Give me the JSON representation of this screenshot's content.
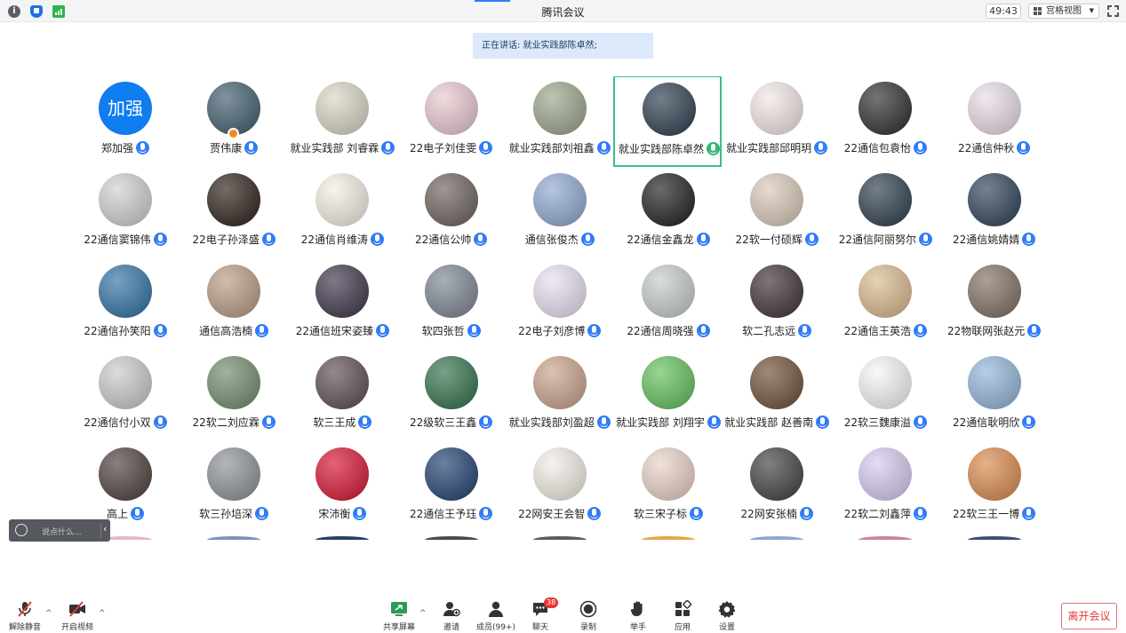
{
  "window": {
    "title": "腾讯会议",
    "timer": "49:43",
    "view_mode": "宫格视图"
  },
  "banner": {
    "speaking": "正在讲话: 就业实践部陈卓然;"
  },
  "participants": [
    {
      "name": "郑加强",
      "avatar_text": "加强",
      "avatar_color": "#0f7cf0"
    },
    {
      "name": "贾伟康",
      "avatar_color": "#3d5a6c",
      "host": true
    },
    {
      "name": "就业实践部 刘睿霖",
      "avatar_color": "#d9d4c3"
    },
    {
      "name": "22电子刘佳雯",
      "avatar_color": "#e8c8cf"
    },
    {
      "name": "就业实践部刘祖鑫",
      "avatar_color": "#9aa489"
    },
    {
      "name": "就业实践部陈卓然",
      "avatar_color": "#2b3a4d",
      "speaking": true
    },
    {
      "name": "就业实践部邱明玥",
      "avatar_color": "#f2e7e4"
    },
    {
      "name": "22通信包袁怡",
      "avatar_color": "#2a2a2a"
    },
    {
      "name": "22通信仲秋",
      "avatar_color": "#eadbe6"
    },
    {
      "name": "22通信窦锦伟",
      "avatar_color": "#cfcfcf"
    },
    {
      "name": "22电子孙泽盛",
      "avatar_color": "#2a1d16"
    },
    {
      "name": "22通信肖维涛",
      "avatar_color": "#f4efe3"
    },
    {
      "name": "22通信公帅",
      "avatar_color": "#6a5f5a"
    },
    {
      "name": "通信张俊杰",
      "avatar_color": "#8ea7cf"
    },
    {
      "name": "22通信金鑫龙",
      "avatar_color": "#1b1b1b"
    },
    {
      "name": "22软一付硕辉",
      "avatar_color": "#d8c8b8"
    },
    {
      "name": "22通信阿丽努尔",
      "avatar_color": "#2a3a4c"
    },
    {
      "name": "22通信姚婧婧",
      "avatar_color": "#2a3e55"
    },
    {
      "name": "22通信孙笑阳",
      "avatar_color": "#2d6fa3"
    },
    {
      "name": "通信高浩楠",
      "avatar_color": "#b79a82"
    },
    {
      "name": "22通信班宋姿臻",
      "avatar_color": "#3a3246"
    },
    {
      "name": "软四张哲",
      "avatar_color": "#7b8490"
    },
    {
      "name": "22电子刘彦博",
      "avatar_color": "#e9dff1"
    },
    {
      "name": "22通信周晓强",
      "avatar_color": "#c4ccc9"
    },
    {
      "name": "软二孔志远",
      "avatar_color": "#3c2d32"
    },
    {
      "name": "22通信王英浩",
      "avatar_color": "#d9b98d"
    },
    {
      "name": "22物联网张赵元",
      "avatar_color": "#7d6e5f"
    },
    {
      "name": "22通信付小双",
      "avatar_color": "#c9c9c9"
    },
    {
      "name": "22软二刘应霖",
      "avatar_color": "#6f8a6a"
    },
    {
      "name": "软三王成",
      "avatar_color": "#5a4a52"
    },
    {
      "name": "22级软三王鑫",
      "avatar_color": "#2f6f48"
    },
    {
      "name": "就业实践部刘盈超",
      "avatar_color": "#c9a189"
    },
    {
      "name": "就业实践部 刘翔宇",
      "avatar_color": "#5fbf5a"
    },
    {
      "name": "就业实践部 赵善南",
      "avatar_color": "#6b4b33"
    },
    {
      "name": "22软三魏康溢",
      "avatar_color": "#f6f6f6"
    },
    {
      "name": "22通信耿明欣",
      "avatar_color": "#8fb4d8"
    },
    {
      "name": "高上",
      "avatar_color": "#4a3d38"
    },
    {
      "name": "软三孙培深",
      "avatar_color": "#8b8f96"
    },
    {
      "name": "宋沛衡",
      "avatar_color": "#d6102e"
    },
    {
      "name": "22通信王予珏",
      "avatar_color": "#1d3d6e"
    },
    {
      "name": "22网安王会智",
      "avatar_color": "#f2ece4"
    },
    {
      "name": "软三宋子标",
      "avatar_color": "#e8d1c6"
    },
    {
      "name": "22网安张楠",
      "avatar_color": "#3d3d3d"
    },
    {
      "name": "22软二刘鑫萍",
      "avatar_color": "#d8c8ef"
    },
    {
      "name": "22软三王一博",
      "avatar_color": "#d9884a"
    }
  ],
  "chat": {
    "placeholder": "说点什么..."
  },
  "toolbar": {
    "mute": "解除静音",
    "video": "开启视频",
    "share": "共享屏幕",
    "invite": "邀请",
    "members": "成员(99+)",
    "chat": "聊天",
    "chat_badge": "38",
    "record": "录制",
    "raise_hand": "举手",
    "apps": "应用",
    "settings": "设置",
    "leave": "离开会议"
  }
}
